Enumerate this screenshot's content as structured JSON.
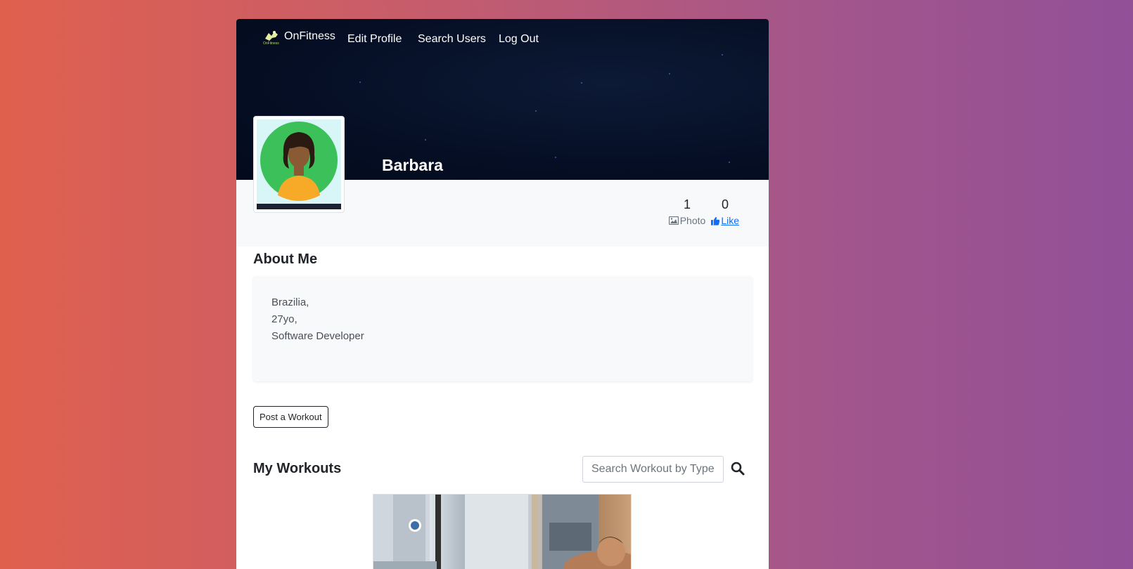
{
  "nav": {
    "brand": "OnFitness",
    "brand_mini": "OnFitness",
    "links": [
      "Edit Profile",
      "Search Users",
      "Log Out"
    ]
  },
  "profile": {
    "name": "Barbara",
    "stats": {
      "photos_count": "1",
      "photos_label": "Photo",
      "likes_count": "0",
      "likes_label": "Like"
    }
  },
  "about": {
    "title": "About Me",
    "lines": [
      "Brazilia,",
      "27yo,",
      "Software Developer"
    ]
  },
  "actions": {
    "post_workout": "Post a Workout"
  },
  "workouts": {
    "title": "My Workouts",
    "search_placeholder": "Search Workout by Type"
  },
  "colors": {
    "link": "#0d6efd",
    "cover": "#050e24"
  }
}
